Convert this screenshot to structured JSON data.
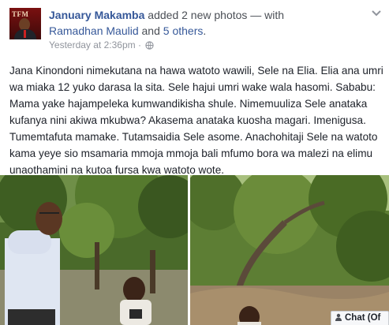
{
  "post": {
    "author": "January Makamba",
    "action": "added 2 new photos",
    "with_sep": "— with",
    "tagged_person": "Ramadhan Maulid",
    "and_word": "and",
    "others_link": "5 others",
    "period": ".",
    "timestamp": "Yesterday at 2:36pm",
    "privacy_icon": "globe-icon",
    "avatar_text": "TFM",
    "body": "Jana Kinondoni nimekutana na hawa watoto wawili, Sele na Elia. Elia ana umri wa miaka 12 yuko darasa la sita. Sele hajui umri wake wala hasomi. Sababu: Mama yake hajampeleka kumwandikisha shule. Nimemuuliza Sele anataka kufanya nini akiwa mkubwa? Akasema anataka kuosha magari. Imenigusa. Tumemtafuta mamake. Tutamsaidia Sele asome. Anachohitaji Sele na watoto kama yeye sio msamaria mmoja mmoja bali mfumo bora wa malezi na elimu unaothamini na kutoa fursa kwa watoto wote."
  },
  "photos": [
    {
      "description": "man in white shirt with boy under trees"
    },
    {
      "description": "boy near tree and dirt ground"
    }
  ],
  "chat": {
    "label": "Chat (Of",
    "icon": "person-icon"
  },
  "colors": {
    "link": "#365899",
    "text": "#1d2129",
    "meta": "#90949c"
  }
}
